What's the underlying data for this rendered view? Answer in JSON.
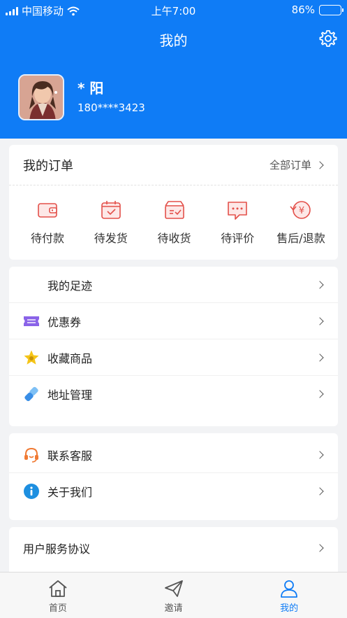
{
  "status_bar": {
    "carrier": "中国移动",
    "time": "上午7:00",
    "battery": "86%",
    "battery_level": 0.86
  },
  "header": {
    "title": "我的",
    "settings_icon": "gear-icon"
  },
  "profile": {
    "name": "* 阳",
    "phone": "180****3423"
  },
  "orders": {
    "title": "我的订单",
    "all_label": "全部订单",
    "items": [
      {
        "label": "待付款",
        "icon": "wallet-icon"
      },
      {
        "label": "待发货",
        "icon": "calendar-check-icon"
      },
      {
        "label": "待收货",
        "icon": "package-icon"
      },
      {
        "label": "待评价",
        "icon": "chat-bubble-icon"
      },
      {
        "label": "售后/退款",
        "icon": "refund-icon"
      }
    ]
  },
  "menu1": [
    {
      "label": "我的足迹",
      "icon": ""
    },
    {
      "label": "优惠券",
      "icon": "coupon-icon"
    },
    {
      "label": "收藏商品",
      "icon": "star-icon"
    },
    {
      "label": "地址管理",
      "icon": "link-icon"
    }
  ],
  "menu2": [
    {
      "label": "联系客服",
      "icon": "headset-icon"
    },
    {
      "label": "关于我们",
      "icon": "info-icon"
    }
  ],
  "menu3": [
    {
      "label": "用户服务协议"
    }
  ],
  "tabbar": [
    {
      "label": "首页",
      "icon": "home-icon"
    },
    {
      "label": "邀请",
      "icon": "paper-plane-icon"
    },
    {
      "label": "我的",
      "icon": "user-icon",
      "active": true
    }
  ],
  "colors": {
    "brand": "#0f7cf6",
    "order_icon": "#e3504a",
    "coupon": "#8a63e8",
    "star": "#f5c518",
    "link": "#3a8ee6",
    "headset": "#f07a33",
    "info": "#1d8fe0"
  }
}
